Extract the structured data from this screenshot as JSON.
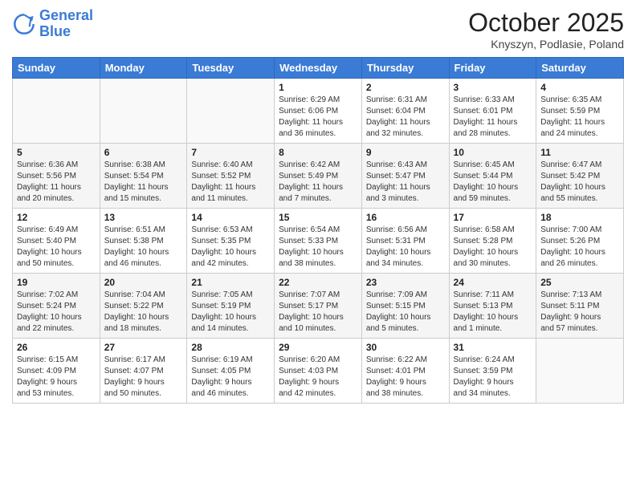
{
  "logo": {
    "line1": "General",
    "line2": "Blue"
  },
  "header": {
    "month": "October 2025",
    "location": "Knyszyn, Podlasie, Poland"
  },
  "days_of_week": [
    "Sunday",
    "Monday",
    "Tuesday",
    "Wednesday",
    "Thursday",
    "Friday",
    "Saturday"
  ],
  "weeks": [
    [
      {
        "day": "",
        "info": ""
      },
      {
        "day": "",
        "info": ""
      },
      {
        "day": "",
        "info": ""
      },
      {
        "day": "1",
        "info": "Sunrise: 6:29 AM\nSunset: 6:06 PM\nDaylight: 11 hours\nand 36 minutes."
      },
      {
        "day": "2",
        "info": "Sunrise: 6:31 AM\nSunset: 6:04 PM\nDaylight: 11 hours\nand 32 minutes."
      },
      {
        "day": "3",
        "info": "Sunrise: 6:33 AM\nSunset: 6:01 PM\nDaylight: 11 hours\nand 28 minutes."
      },
      {
        "day": "4",
        "info": "Sunrise: 6:35 AM\nSunset: 5:59 PM\nDaylight: 11 hours\nand 24 minutes."
      }
    ],
    [
      {
        "day": "5",
        "info": "Sunrise: 6:36 AM\nSunset: 5:56 PM\nDaylight: 11 hours\nand 20 minutes."
      },
      {
        "day": "6",
        "info": "Sunrise: 6:38 AM\nSunset: 5:54 PM\nDaylight: 11 hours\nand 15 minutes."
      },
      {
        "day": "7",
        "info": "Sunrise: 6:40 AM\nSunset: 5:52 PM\nDaylight: 11 hours\nand 11 minutes."
      },
      {
        "day": "8",
        "info": "Sunrise: 6:42 AM\nSunset: 5:49 PM\nDaylight: 11 hours\nand 7 minutes."
      },
      {
        "day": "9",
        "info": "Sunrise: 6:43 AM\nSunset: 5:47 PM\nDaylight: 11 hours\nand 3 minutes."
      },
      {
        "day": "10",
        "info": "Sunrise: 6:45 AM\nSunset: 5:44 PM\nDaylight: 10 hours\nand 59 minutes."
      },
      {
        "day": "11",
        "info": "Sunrise: 6:47 AM\nSunset: 5:42 PM\nDaylight: 10 hours\nand 55 minutes."
      }
    ],
    [
      {
        "day": "12",
        "info": "Sunrise: 6:49 AM\nSunset: 5:40 PM\nDaylight: 10 hours\nand 50 minutes."
      },
      {
        "day": "13",
        "info": "Sunrise: 6:51 AM\nSunset: 5:38 PM\nDaylight: 10 hours\nand 46 minutes."
      },
      {
        "day": "14",
        "info": "Sunrise: 6:53 AM\nSunset: 5:35 PM\nDaylight: 10 hours\nand 42 minutes."
      },
      {
        "day": "15",
        "info": "Sunrise: 6:54 AM\nSunset: 5:33 PM\nDaylight: 10 hours\nand 38 minutes."
      },
      {
        "day": "16",
        "info": "Sunrise: 6:56 AM\nSunset: 5:31 PM\nDaylight: 10 hours\nand 34 minutes."
      },
      {
        "day": "17",
        "info": "Sunrise: 6:58 AM\nSunset: 5:28 PM\nDaylight: 10 hours\nand 30 minutes."
      },
      {
        "day": "18",
        "info": "Sunrise: 7:00 AM\nSunset: 5:26 PM\nDaylight: 10 hours\nand 26 minutes."
      }
    ],
    [
      {
        "day": "19",
        "info": "Sunrise: 7:02 AM\nSunset: 5:24 PM\nDaylight: 10 hours\nand 22 minutes."
      },
      {
        "day": "20",
        "info": "Sunrise: 7:04 AM\nSunset: 5:22 PM\nDaylight: 10 hours\nand 18 minutes."
      },
      {
        "day": "21",
        "info": "Sunrise: 7:05 AM\nSunset: 5:19 PM\nDaylight: 10 hours\nand 14 minutes."
      },
      {
        "day": "22",
        "info": "Sunrise: 7:07 AM\nSunset: 5:17 PM\nDaylight: 10 hours\nand 10 minutes."
      },
      {
        "day": "23",
        "info": "Sunrise: 7:09 AM\nSunset: 5:15 PM\nDaylight: 10 hours\nand 5 minutes."
      },
      {
        "day": "24",
        "info": "Sunrise: 7:11 AM\nSunset: 5:13 PM\nDaylight: 10 hours\nand 1 minute."
      },
      {
        "day": "25",
        "info": "Sunrise: 7:13 AM\nSunset: 5:11 PM\nDaylight: 9 hours\nand 57 minutes."
      }
    ],
    [
      {
        "day": "26",
        "info": "Sunrise: 6:15 AM\nSunset: 4:09 PM\nDaylight: 9 hours\nand 53 minutes."
      },
      {
        "day": "27",
        "info": "Sunrise: 6:17 AM\nSunset: 4:07 PM\nDaylight: 9 hours\nand 50 minutes."
      },
      {
        "day": "28",
        "info": "Sunrise: 6:19 AM\nSunset: 4:05 PM\nDaylight: 9 hours\nand 46 minutes."
      },
      {
        "day": "29",
        "info": "Sunrise: 6:20 AM\nSunset: 4:03 PM\nDaylight: 9 hours\nand 42 minutes."
      },
      {
        "day": "30",
        "info": "Sunrise: 6:22 AM\nSunset: 4:01 PM\nDaylight: 9 hours\nand 38 minutes."
      },
      {
        "day": "31",
        "info": "Sunrise: 6:24 AM\nSunset: 3:59 PM\nDaylight: 9 hours\nand 34 minutes."
      },
      {
        "day": "",
        "info": ""
      }
    ]
  ]
}
